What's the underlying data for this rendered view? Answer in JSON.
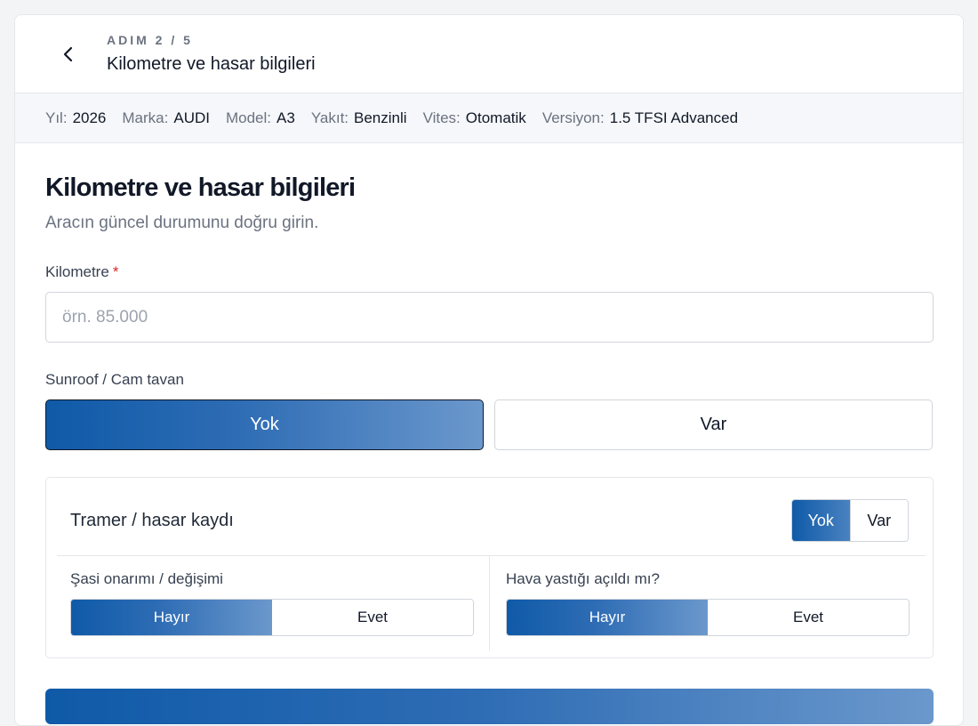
{
  "header": {
    "step": "ADIM 2 / 5",
    "title": "Kilometre ve hasar bilgileri"
  },
  "info": [
    {
      "key": "Yıl:",
      "value": "2026"
    },
    {
      "key": "Marka:",
      "value": "AUDI"
    },
    {
      "key": "Model:",
      "value": "A3"
    },
    {
      "key": "Yakıt:",
      "value": "Benzinli"
    },
    {
      "key": "Vites:",
      "value": "Otomatik"
    },
    {
      "key": "Versiyon:",
      "value": "1.5 TFSI Advanced"
    }
  ],
  "main": {
    "title": "Kilometre ve hasar bilgileri",
    "subtitle": "Aracın güncel durumunu doğru girin.",
    "km": {
      "label": "Kilometre",
      "required": "*",
      "placeholder": "örn. 85.000",
      "value": ""
    },
    "sunroof": {
      "label": "Sunroof / Cam tavan",
      "options": [
        "Yok",
        "Var"
      ],
      "selected": "Yok"
    },
    "tramer": {
      "title": "Tramer / hasar kaydı",
      "options": [
        "Yok",
        "Var"
      ],
      "selected": "Yok",
      "chassis": {
        "label": "Şasi onarımı / değişimi",
        "options": [
          "Hayır",
          "Evet"
        ],
        "selected": "Hayır"
      },
      "airbag": {
        "label": "Hava yastığı açıldı mı?",
        "options": [
          "Hayır",
          "Evet"
        ],
        "selected": "Hayır"
      }
    }
  },
  "colors": {
    "accent": "#0f5aa8",
    "required": "#dc2626"
  },
  "icons": {
    "back": "chevron-left-icon"
  }
}
